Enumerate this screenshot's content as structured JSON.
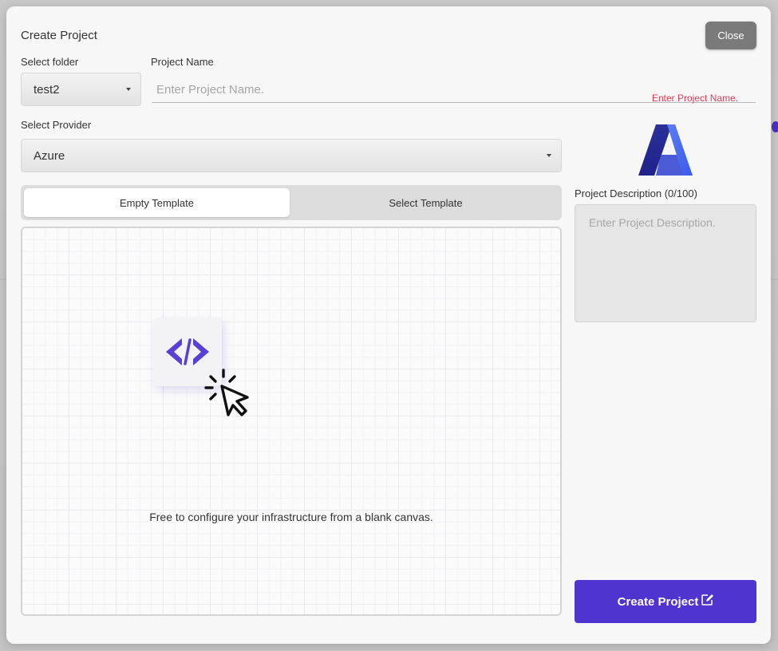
{
  "modal": {
    "title": "Create Project",
    "close_label": "Close"
  },
  "folder": {
    "label": "Select folder",
    "value": "test2"
  },
  "project_name": {
    "label": "Project Name",
    "placeholder": "Enter Project Name.",
    "error": "Enter Project Name."
  },
  "provider": {
    "label": "Select Provider",
    "value": "Azure",
    "logo_icon": "azure-logo-icon"
  },
  "template_tabs": [
    {
      "label": "Empty Template",
      "active": true
    },
    {
      "label": "Select Template",
      "active": false
    }
  ],
  "canvas": {
    "caption": "Free to configure your infrastructure from a blank canvas.",
    "icons": [
      "code-brackets-icon",
      "click-cursor-icon"
    ]
  },
  "description": {
    "label": "Project Description (0/100)",
    "placeholder": "Enter Project Description."
  },
  "create_button": {
    "label": "Create Project",
    "icon": "edit-note-icon"
  },
  "colors": {
    "accent": "#4f34cf",
    "error": "#d0445c",
    "close_button": "#7a7a7a"
  }
}
